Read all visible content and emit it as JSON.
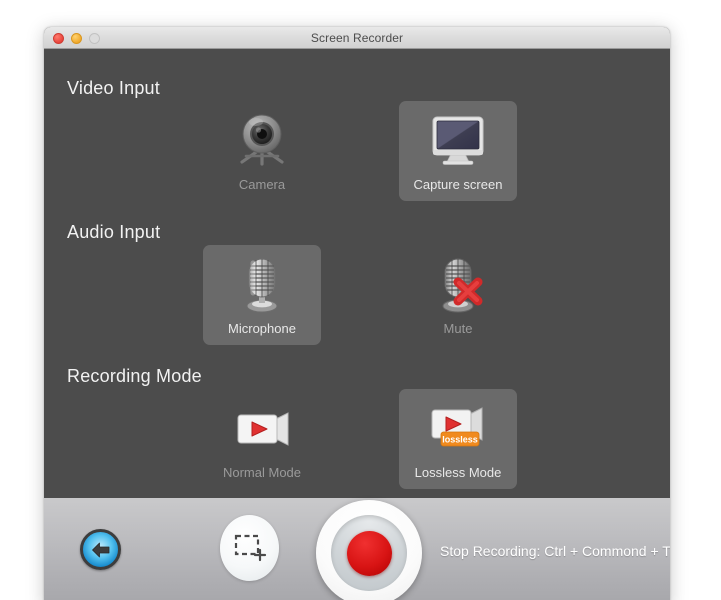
{
  "window": {
    "title": "Screen Recorder",
    "traffic_lights": [
      {
        "name": "close",
        "color": "#e8453c",
        "enabled": true
      },
      {
        "name": "minimize",
        "color": "#f0a92c",
        "enabled": true
      },
      {
        "name": "zoom",
        "color": "#dcdcdc",
        "enabled": false
      }
    ]
  },
  "sections": {
    "video_input": {
      "title": "Video Input",
      "options": [
        {
          "label": "Camera",
          "icon": "webcam-icon",
          "selected": false
        },
        {
          "label": "Capture screen",
          "icon": "monitor-icon",
          "selected": true
        }
      ]
    },
    "audio_input": {
      "title": "Audio Input",
      "options": [
        {
          "label": "Microphone",
          "icon": "microphone-icon",
          "selected": true
        },
        {
          "label": "Mute",
          "icon": "microphone-muted-icon",
          "selected": false
        }
      ]
    },
    "recording_mode": {
      "title": "Recording Mode",
      "options": [
        {
          "label": "Normal Mode",
          "icon": "camcorder-icon",
          "selected": false
        },
        {
          "label": "Lossless Mode",
          "icon": "camcorder-lossless-icon",
          "badge": "lossless",
          "selected": true
        }
      ]
    }
  },
  "toolbar": {
    "back_button": {
      "name": "back-button",
      "icon": "arrow-left-icon"
    },
    "crop_button": {
      "name": "select-region-button",
      "icon": "dashed-rect-plus-icon"
    },
    "record_button": {
      "name": "record-button",
      "icon": "record-dot-icon"
    },
    "stop_hint": "Stop Recording: Ctrl + Commond + T"
  },
  "colors": {
    "panel_bg": "#4c4c4c",
    "tile_selected_bg": "#6a6a6a",
    "record_red": "#d81414",
    "badge_orange": "#f08a1e",
    "back_blue": "#1b8fd0"
  }
}
